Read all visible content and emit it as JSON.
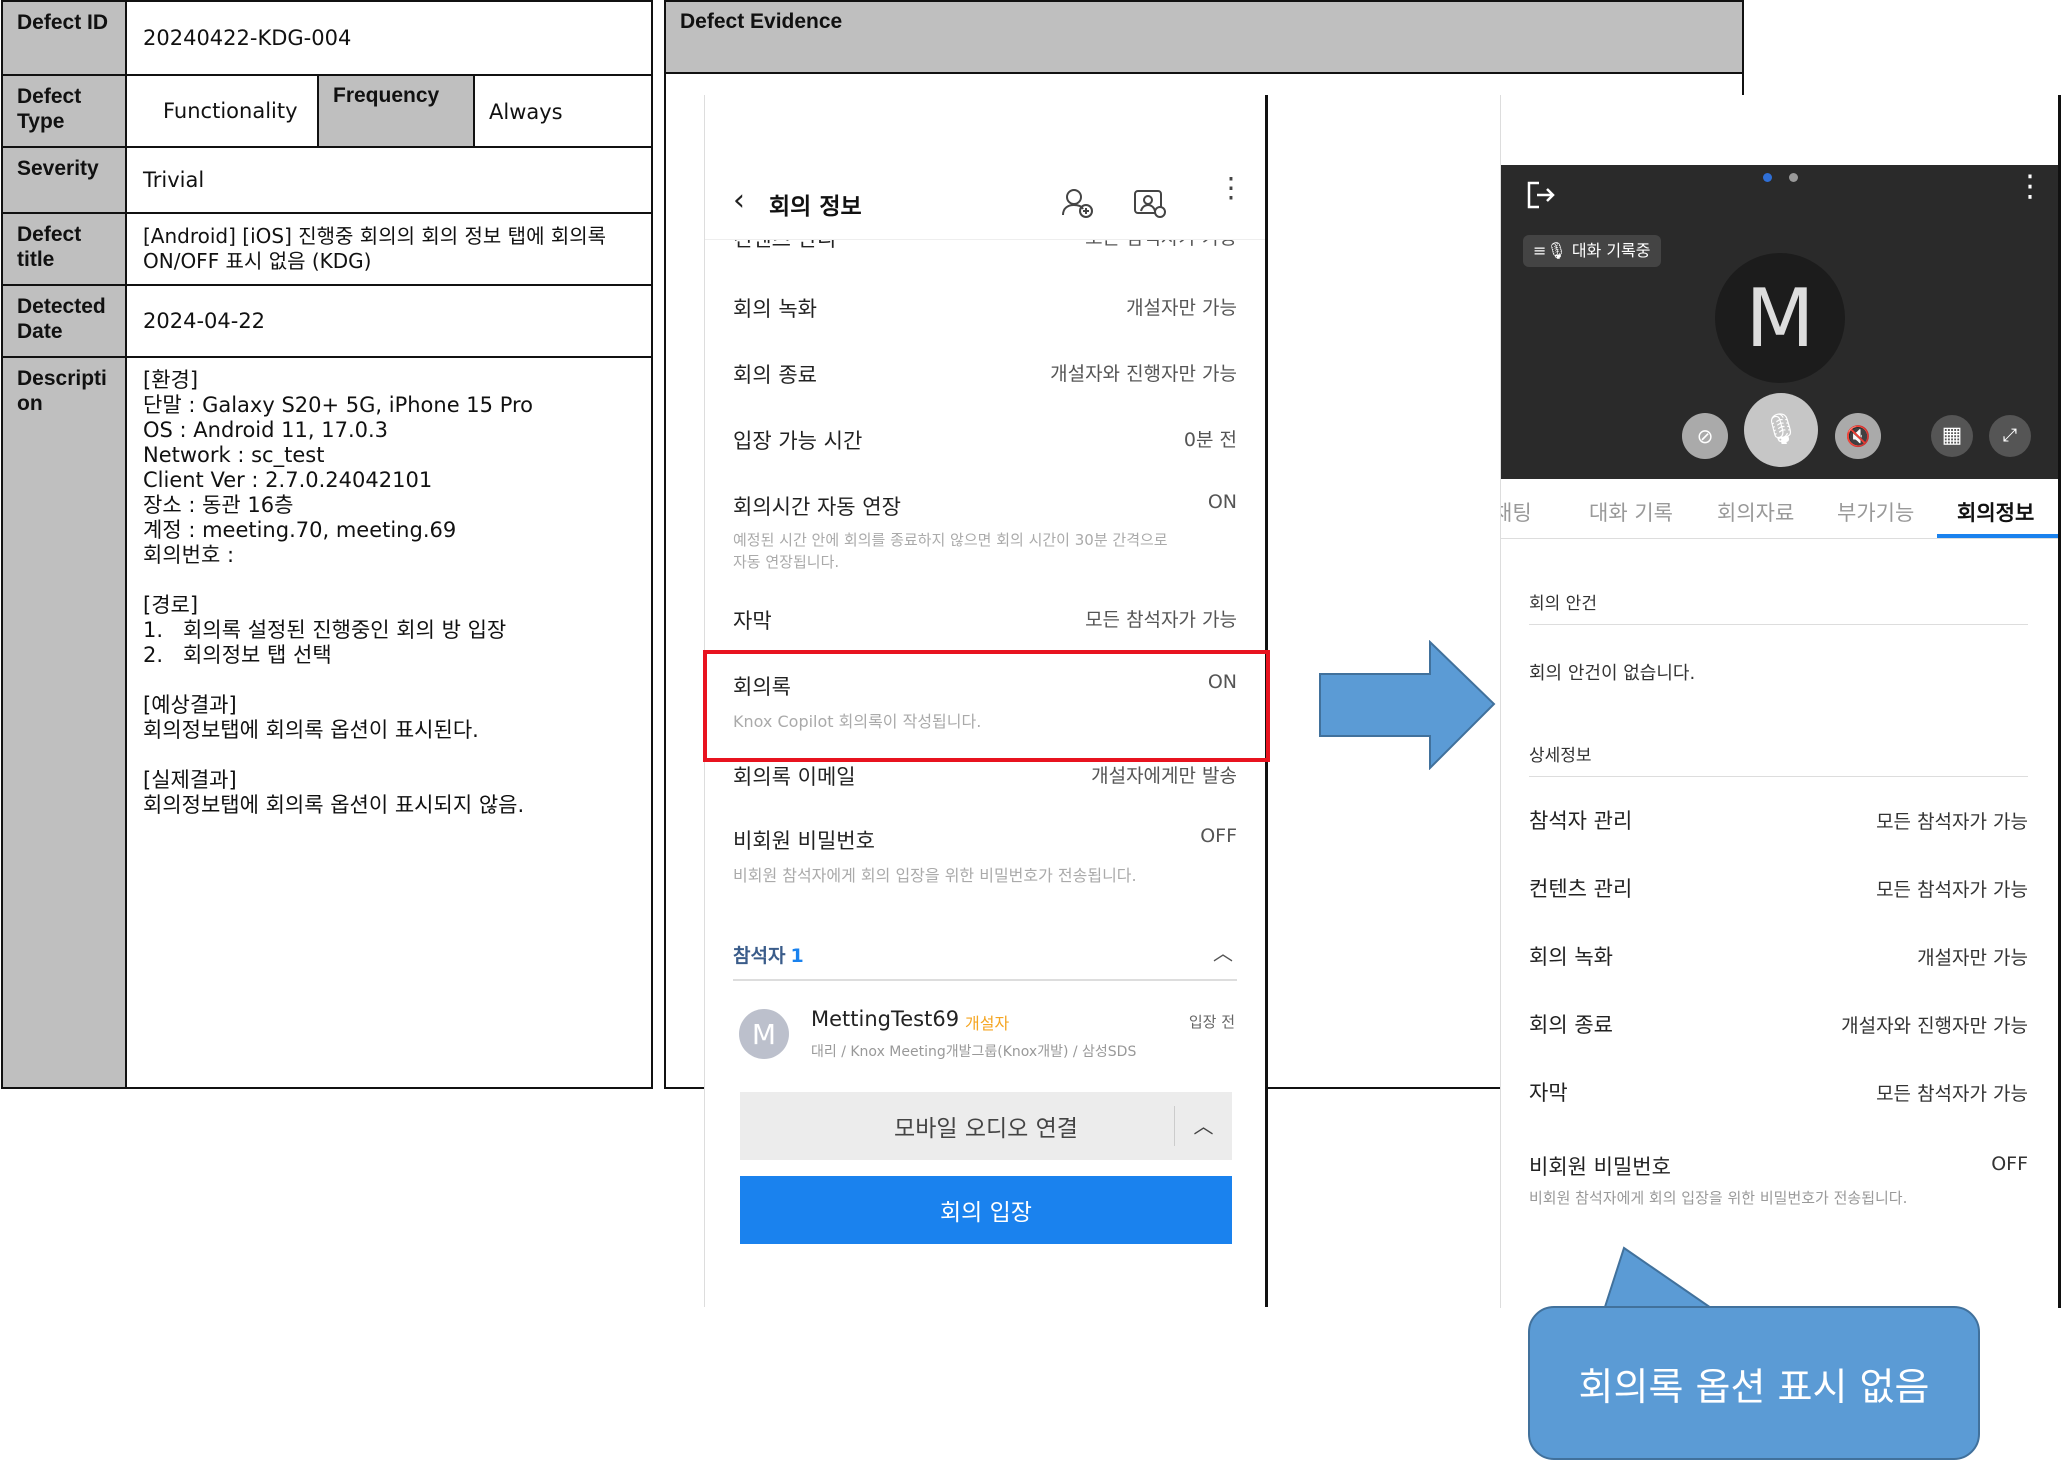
{
  "table": {
    "id_label": "Defect ID",
    "id_value": "20240422-KDG-004",
    "type_label": "Defect Type",
    "type_value": "Functionality",
    "freq_label": "Frequency",
    "freq_value": "Always",
    "severity_label": "Severity",
    "severity_value": "Trivial",
    "title_label": "Defect title",
    "title_value": "[Android] [iOS] 진행중 회의의 회의 정보 탭에 회의록 ON/OFF 표시 없음 (KDG)",
    "date_label": "Detected Date",
    "date_value": "2024-04-22",
    "desc_label": "Descripti on",
    "desc_value": "[환경]\n단말 : Galaxy S20+ 5G, iPhone 15 Pro\nOS : Android 11, 17.0.3\nNetwork : sc_test\nClient Ver : 2.7.0.24042101\n장소 : 동관 16층\n계정 : meeting.70, meeting.69\n회의번호 :\n\n[경로]\n1.   회의록 설정된 진행중인 회의 방 입장\n2.   회의정보 탭 선택\n\n[예상결과]\n회의정보탭에 회의록 옵션이 표시된다.\n\n[실제결과]\n회의정보탭에 회의록 옵션이 표시되지 않음."
  },
  "evidence": {
    "header": "Defect Evidence",
    "phone1": {
      "title": "회의 정보",
      "cut_label": "컨텐츠 관리",
      "cut_value": "모든 참석자가 가능",
      "rows": [
        {
          "label": "회의 녹화",
          "value": "개설자만 가능"
        },
        {
          "label": "회의 종료",
          "value": "개설자와 진행자만 가능"
        },
        {
          "label": "입장 가능 시간",
          "value": "0분 전"
        }
      ],
      "auto_extend_label": "회의시간 자동 연장",
      "auto_extend_value": "ON",
      "auto_extend_sub": "예정된 시간 안에 회의를 종료하지 않으면 회의 시간이 30분 간격으로 자동 연장됩니다.",
      "caption_label": "자막",
      "caption_value": "모든 참석자가 가능",
      "minutes_label": "회의록",
      "minutes_value": "ON",
      "minutes_sub": "Knox Copilot 회의록이 작성됩니다.",
      "email_label": "회의록 이메일",
      "email_value": "개설자에게만 발송",
      "pw_label": "비회원 비밀번호",
      "pw_value": "OFF",
      "pw_sub": "비회원 참석자에게 회의 입장을 위한 비밀번호가 전송됩니다.",
      "participants_label": "참석자",
      "participants_count": "1",
      "participant_avatar": "M",
      "participant_name": "MettingTest69",
      "participant_role": "개설자",
      "participant_status": "입장 전",
      "participant_org": "대리 / Knox Meeting개발그룹(Knox개발) / 삼성SDS",
      "audio_btn": "모바일 오디오 연결",
      "enter_btn": "회의 입장"
    },
    "phone2": {
      "recording_badge": "대화 기록중",
      "avatar_letter": "M",
      "tabs": [
        "채팅",
        "대화 기록",
        "회의자료",
        "부가기능",
        "회의정보"
      ],
      "agenda_label": "회의 안건",
      "agenda_empty": "회의 안건이 없습니다.",
      "detail_label": "상세정보",
      "rows": [
        {
          "label": "참석자 관리",
          "value": "모든 참석자가 가능"
        },
        {
          "label": "컨텐츠 관리",
          "value": "모든 참석자가 가능"
        },
        {
          "label": "회의 녹화",
          "value": "개설자만 가능"
        },
        {
          "label": "회의 종료",
          "value": "개설자와 진행자만 가능"
        },
        {
          "label": "자막",
          "value": "모든 참석자가 가능"
        }
      ],
      "pw_label": "비회원 비밀번호",
      "pw_value": "OFF",
      "pw_sub": "비회원 참석자에게 회의 입장을 위한 비밀번호가 전송됩니다."
    },
    "callout": "회의록 옵션 표시 없음",
    "colors": {
      "highlight": "#e8131f",
      "arrow": "#5b9bd5",
      "primary_button": "#1a82ee",
      "creator_tag": "#f5a623"
    }
  }
}
